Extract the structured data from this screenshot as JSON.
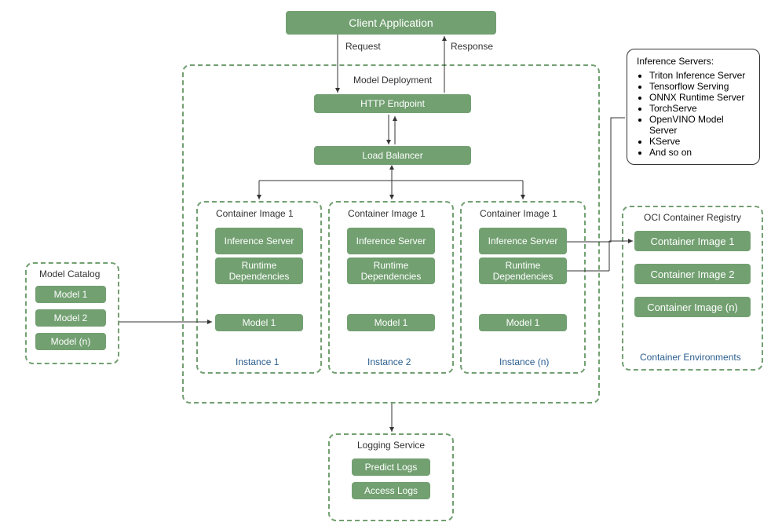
{
  "diagram": {
    "client": "Client Application",
    "request_label": "Request",
    "response_label": "Response",
    "model_deployment_title": "Model Deployment",
    "http_endpoint": "HTTP Endpoint",
    "load_balancer": "Load Balancer",
    "containers": [
      {
        "title": "Container Image 1",
        "inference_server": "Inference Server",
        "runtime": "Runtime Dependencies",
        "model": "Model 1",
        "instance": "Instance 1"
      },
      {
        "title": "Container Image 1",
        "inference_server": "Inference Server",
        "runtime": "Runtime Dependencies",
        "model": "Model 1",
        "instance": "Instance 2"
      },
      {
        "title": "Container Image 1",
        "inference_server": "Inference Server",
        "runtime": "Runtime Dependencies",
        "model": "Model 1",
        "instance": "Instance (n)"
      }
    ],
    "model_catalog": {
      "title": "Model Catalog",
      "items": [
        "Model 1",
        "Model 2",
        "Model (n)"
      ]
    },
    "logging_service": {
      "title": "Logging Service",
      "items": [
        "Predict Logs",
        "Access Logs"
      ]
    },
    "registry": {
      "title": "OCI Container Registry",
      "items": [
        "Container Image 1",
        "Container Image 2",
        "Container Image (n)"
      ],
      "footer": "Container Environments"
    },
    "legend": {
      "title": "Inference Servers:",
      "items": [
        "Triton Inference Server",
        "Tensorflow Serving",
        "ONNX Runtime Server",
        "TorchServe",
        "OpenVINO Model Server",
        "KServe",
        "And so on"
      ]
    }
  }
}
